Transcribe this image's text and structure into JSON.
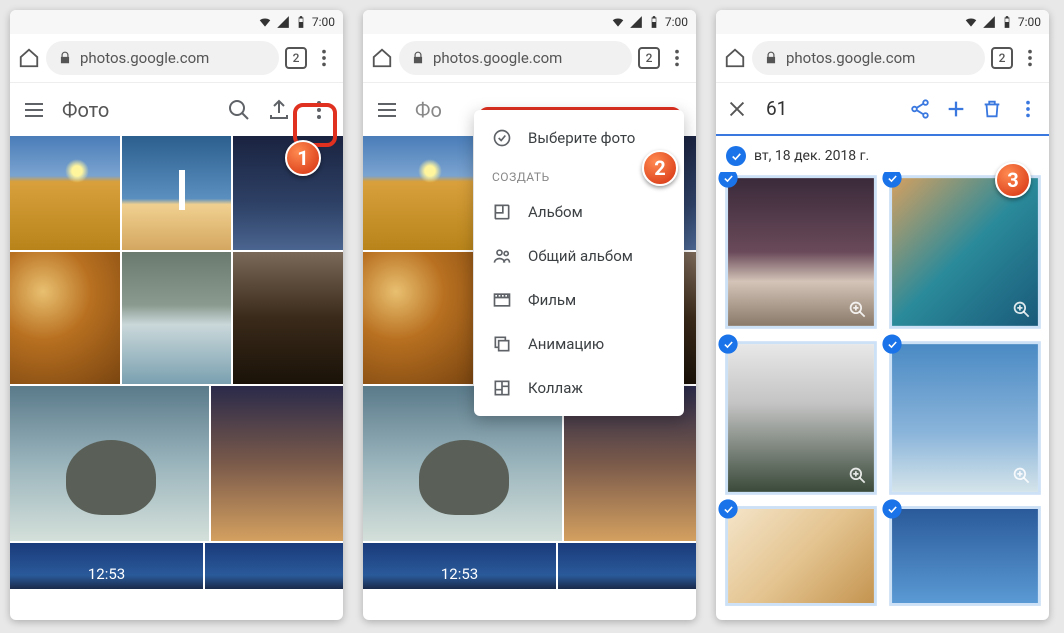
{
  "status": {
    "time": "7:00"
  },
  "browser": {
    "url": "photos.google.com",
    "tabs": "2"
  },
  "phone1": {
    "appbar_title": "Фото"
  },
  "menu": {
    "select": "Выберите фото",
    "create_header": "СОЗДАТЬ",
    "album": "Альбом",
    "shared_album": "Общий альбом",
    "movie": "Фильм",
    "animation": "Анимацию",
    "collage": "Коллаж"
  },
  "phone3": {
    "count": "61",
    "date": "вт, 18 дек. 2018 г."
  },
  "badges": {
    "one": "1",
    "two": "2",
    "three": "3"
  },
  "desktime": "12:53"
}
